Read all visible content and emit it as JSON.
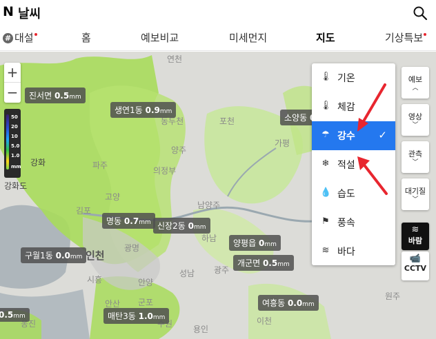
{
  "header": {
    "logo": "N",
    "title": "날씨",
    "search_icon": "search-icon"
  },
  "nav": {
    "tabs": [
      {
        "label": "대설",
        "hash": "#",
        "dot": true,
        "active": false
      },
      {
        "label": "홈",
        "active": false
      },
      {
        "label": "예보비교",
        "active": false
      },
      {
        "label": "미세먼지",
        "active": false
      },
      {
        "label": "지도",
        "active": true
      },
      {
        "label": "기상특보",
        "dot": true,
        "active": false
      }
    ]
  },
  "zoom": {
    "in": "+",
    "out": "−"
  },
  "legend": {
    "ticks": [
      "50",
      "20",
      "10",
      "5.0",
      "1.0",
      "mm"
    ]
  },
  "precip_labels": [
    {
      "name": "진서면",
      "value": "0.5",
      "unit": "mm"
    },
    {
      "name": "생연1동",
      "value": "0.9",
      "unit": "mm"
    },
    {
      "name": "소양동",
      "value": "0",
      "unit": ""
    },
    {
      "name": "명동",
      "value": "0.7",
      "unit": "mm"
    },
    {
      "name": "신장2동",
      "value": "0",
      "unit": "mm"
    },
    {
      "name": "구월1동",
      "value": "0.0",
      "unit": "mm"
    },
    {
      "name": "양평읍",
      "value": "0",
      "unit": "mm"
    },
    {
      "name": "개군면",
      "value": "0.5",
      "unit": "mm"
    },
    {
      "name": "여흥동",
      "value": "0.0",
      "unit": "mm"
    },
    {
      "name": "매탄3동",
      "value": "1.0",
      "unit": "mm"
    },
    {
      "name": "",
      "value": "0.5",
      "unit": "mm"
    }
  ],
  "places": [
    "연천",
    "동두천",
    "포천",
    "가평",
    "양주",
    "의정부",
    "파주",
    "강화",
    "강화도",
    "고양",
    "김포",
    "남양주",
    "인천",
    "광명",
    "하남",
    "시흥",
    "안양",
    "성남",
    "광주",
    "양평",
    "안산",
    "군포",
    "수원",
    "용인",
    "이천",
    "원주",
    "옹진"
  ],
  "layer_menu": {
    "items": [
      {
        "label": "기온",
        "icon": "thermometer-icon",
        "selected": false
      },
      {
        "label": "체감",
        "icon": "feels-like-thermometer-icon",
        "selected": false
      },
      {
        "label": "강수",
        "icon": "umbrella-icon",
        "selected": true
      },
      {
        "label": "적설",
        "icon": "snowflake-icon",
        "selected": false
      },
      {
        "label": "습도",
        "icon": "water-drop-icon",
        "selected": false
      },
      {
        "label": "풍속",
        "icon": "wind-flag-icon",
        "selected": false
      },
      {
        "label": "바다",
        "icon": "sea-wave-icon",
        "selected": false
      }
    ]
  },
  "side_buttons": [
    {
      "label": "예보",
      "caret": "up"
    },
    {
      "label": "영상",
      "caret": "down"
    },
    {
      "label": "관측",
      "caret": "down"
    },
    {
      "label": "대기질",
      "caret": "down"
    },
    {
      "label": "바람",
      "icon": "wind-icon",
      "active": true
    },
    {
      "label": "CCTV",
      "icon": "cctv-icon"
    }
  ],
  "colors": {
    "accent": "#2478ef",
    "rain_green": "#9ad94a",
    "annotation_red": "#e8262f"
  }
}
